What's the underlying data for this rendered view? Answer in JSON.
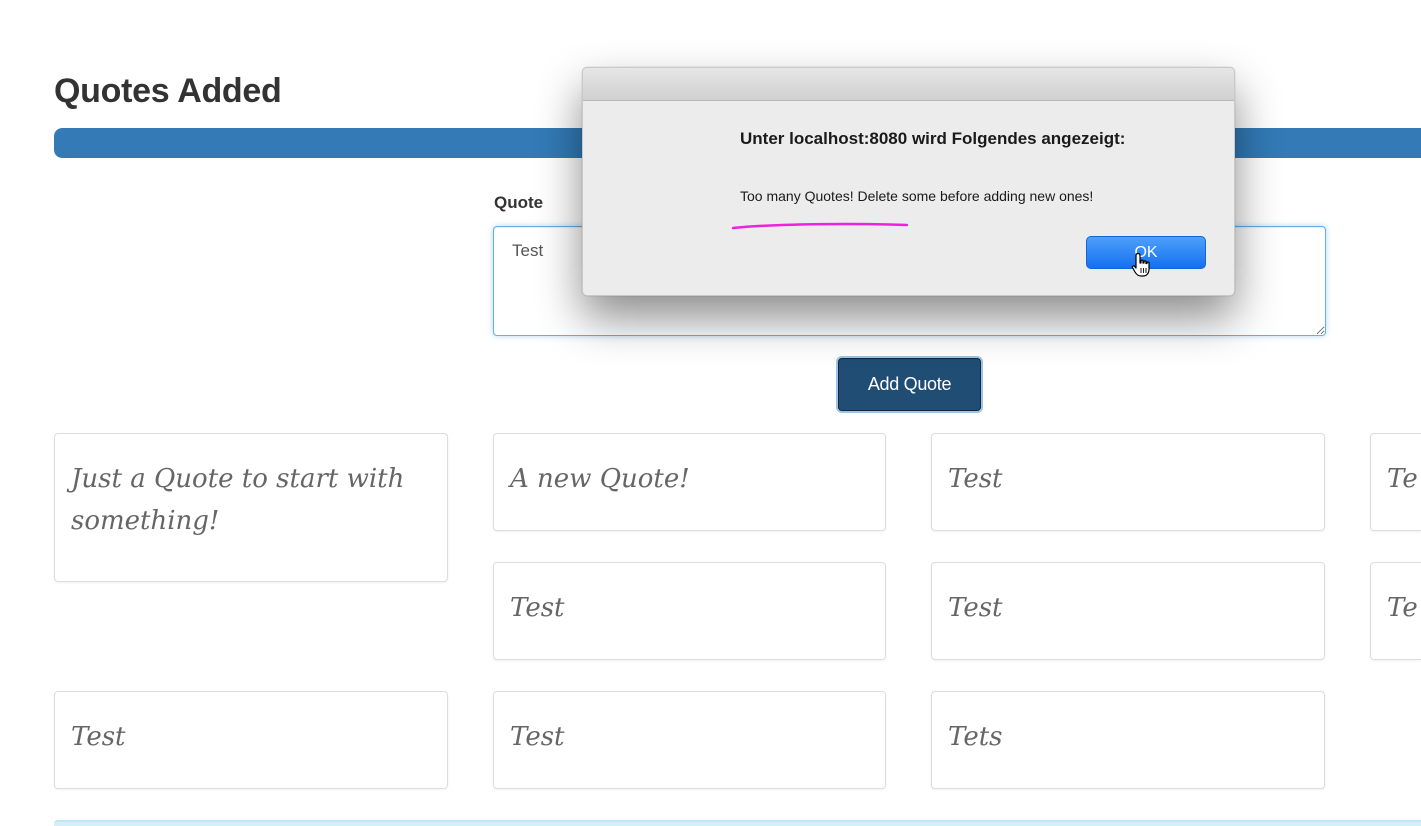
{
  "page": {
    "title": "Quotes Added"
  },
  "progress": {
    "fraction": 1.0,
    "bar_color": "#337ab7"
  },
  "form": {
    "label": "Quote",
    "textarea_value": "Test",
    "submit_label": "Add Quote"
  },
  "quotes": [
    "Just a Quote to start with something!",
    "A new Quote!",
    "Test",
    "Te",
    "Test",
    "Test",
    "Te",
    "Test",
    "Test",
    "Tets"
  ],
  "dialog": {
    "heading": "Unter localhost:8080 wird Folgendes angezeigt:",
    "message": "Too many Quotes! Delete some before adding new ones!",
    "ok_label": "OK",
    "annotation_color": "#ee22dd"
  },
  "colors": {
    "primary": "#337ab7",
    "button_active": "#204d74",
    "dialog_button": "#1a78f5"
  }
}
